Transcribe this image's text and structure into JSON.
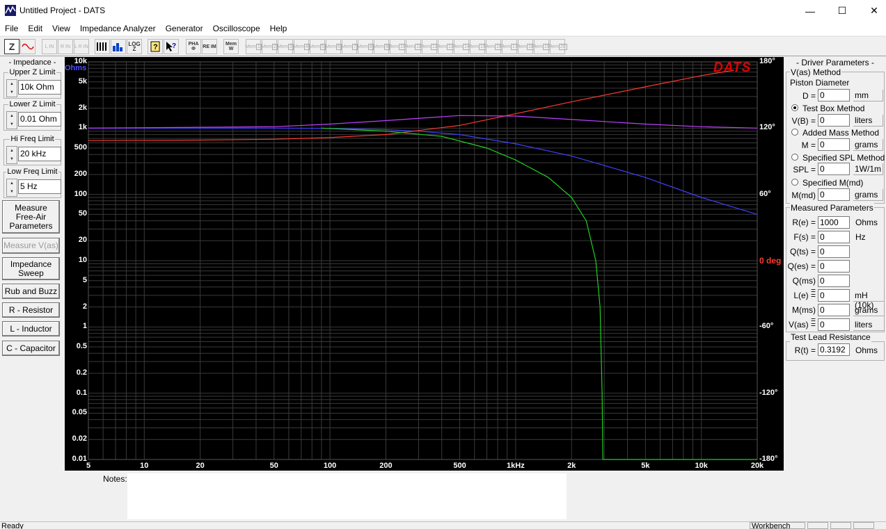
{
  "window": {
    "title": "Untitled Project - DATS"
  },
  "menu": [
    "File",
    "Edit",
    "View",
    "Impedance Analyzer",
    "Generator",
    "Oscilloscope",
    "Help"
  ],
  "toolbar": {
    "left_buttons": [
      "Z",
      "~"
    ],
    "lrl_buttons": [
      "L IN",
      "R IN",
      "L R IN"
    ],
    "view_buttons": [
      "bars",
      "blocks",
      "LOG Z",
      "?",
      "help-cursor",
      "PHA Φ",
      "RE IM",
      "Mem W"
    ],
    "mem_buttons": [
      "1",
      "2",
      "3",
      "4",
      "5",
      "6",
      "7",
      "8",
      "9",
      "10",
      "11",
      "12",
      "13",
      "14",
      "15",
      "16",
      "17",
      "18",
      "19",
      "20"
    ],
    "mem_prefix": "Mem"
  },
  "left": {
    "impedance_title": "- Impedance -",
    "upper_label": "Upper Z Limit",
    "upper_value": "10k Ohm",
    "lower_label": "Lower Z Limit",
    "lower_value": "0.01 Ohm",
    "hifreq_label": "Hi Freq Limit",
    "hifreq_value": "20 kHz",
    "lowfreq_label": "Low Freq Limit",
    "lowfreq_value": "5 Hz",
    "buttons": [
      "Measure Free-Air Parameters",
      "Measure V(as)",
      "Impedance Sweep",
      "Rub and Buzz",
      "R - Resistor",
      "L - Inductor",
      "C - Capacitor"
    ]
  },
  "right": {
    "driver_title": "- Driver Parameters -",
    "vas_method": "V(as) Method",
    "piston": "Piston Diameter",
    "d_label": "D =",
    "d_value": "0",
    "d_unit": "mm",
    "test_box": "Test Box Method",
    "vb_label": "V(B) =",
    "vb_value": "0",
    "vb_unit": "liters",
    "added_mass": "Added Mass Method",
    "m_label": "M =",
    "m_value": "0",
    "m_unit": "grams",
    "spl_method": "Specified SPL Method",
    "spl_label": "SPL =",
    "spl_value": "0",
    "spl_unit": "1W/1m",
    "spec_m": "Specified M(md)",
    "mmd_label": "M(md) =",
    "mmd_value": "0",
    "mmd_unit": "grams",
    "measured_title": "Measured Parameters",
    "params": [
      {
        "label": "R(e) =",
        "value": "1000",
        "unit": "Ohms"
      },
      {
        "label": "F(s) =",
        "value": "0",
        "unit": "Hz"
      },
      {
        "label": "Q(ts) =",
        "value": "0",
        "unit": ""
      },
      {
        "label": "Q(es) =",
        "value": "0",
        "unit": ""
      },
      {
        "label": "Q(ms) =",
        "value": "0",
        "unit": ""
      },
      {
        "label": "L(e) =",
        "value": "0",
        "unit": "mH (10k)"
      },
      {
        "label": "M(ms) =",
        "value": "0",
        "unit": "grams"
      },
      {
        "label": "V(as) =",
        "value": "0",
        "unit": "liters"
      }
    ],
    "lead_title": "Test Lead Resistance",
    "rt_label": "R(t) =",
    "rt_value": "0.3192",
    "rt_unit": "Ohms"
  },
  "notes_label": "Notes:",
  "status": {
    "left": "Ready",
    "right": "Workbench"
  },
  "colors": {
    "impedance": "#4040ff",
    "phase": "#ff3b2f",
    "magenta": "#c040ff",
    "green": "#20d020",
    "logo": "#e00000",
    "grid": "#3a3a3a"
  },
  "chart_data": {
    "type": "line",
    "logo": "DATS",
    "y_unit": "Ohms",
    "right_unit": "deg",
    "xlim": [
      5,
      20000
    ],
    "ylim": [
      0.01,
      10000
    ],
    "phase_lim": [
      -180,
      180
    ],
    "x_ticks": [
      {
        "v": 5,
        "l": "5"
      },
      {
        "v": 10,
        "l": "10"
      },
      {
        "v": 20,
        "l": "20"
      },
      {
        "v": 50,
        "l": "50"
      },
      {
        "v": 100,
        "l": "100"
      },
      {
        "v": 200,
        "l": "200"
      },
      {
        "v": 500,
        "l": "500"
      },
      {
        "v": 1000,
        "l": "1kHz"
      },
      {
        "v": 2000,
        "l": "2k"
      },
      {
        "v": 5000,
        "l": "5k"
      },
      {
        "v": 10000,
        "l": "10k"
      },
      {
        "v": 20000,
        "l": "20k"
      }
    ],
    "y_ticks": [
      {
        "v": 10000,
        "l": "10k"
      },
      {
        "v": 5000,
        "l": "5k"
      },
      {
        "v": 2000,
        "l": "2k"
      },
      {
        "v": 1000,
        "l": "1k"
      },
      {
        "v": 500,
        "l": "500"
      },
      {
        "v": 200,
        "l": "200"
      },
      {
        "v": 100,
        "l": "100"
      },
      {
        "v": 50,
        "l": "50"
      },
      {
        "v": 20,
        "l": "20"
      },
      {
        "v": 10,
        "l": "10"
      },
      {
        "v": 5,
        "l": "5"
      },
      {
        "v": 2,
        "l": "2"
      },
      {
        "v": 1,
        "l": "1"
      },
      {
        "v": 0.5,
        "l": "0.5"
      },
      {
        "v": 0.2,
        "l": "0.2"
      },
      {
        "v": 0.1,
        "l": "0.1"
      },
      {
        "v": 0.05,
        "l": "0.05"
      },
      {
        "v": 0.02,
        "l": "0.02"
      },
      {
        "v": 0.01,
        "l": "0.01"
      }
    ],
    "phase_ticks": [
      {
        "v": 180,
        "l": "180°"
      },
      {
        "v": 120,
        "l": "120°"
      },
      {
        "v": 60,
        "l": "60°"
      },
      {
        "v": 0,
        "l": "0 deg"
      },
      {
        "v": -60,
        "l": "-60°"
      },
      {
        "v": -120,
        "l": "-120°"
      },
      {
        "v": -180,
        "l": "-180°"
      }
    ],
    "series": [
      {
        "key": "blue",
        "axis": "z",
        "points": [
          [
            5,
            1000
          ],
          [
            50,
            1000
          ],
          [
            100,
            990
          ],
          [
            200,
            950
          ],
          [
            300,
            900
          ],
          [
            500,
            800
          ],
          [
            1000,
            580
          ],
          [
            2000,
            380
          ],
          [
            5000,
            180
          ],
          [
            10000,
            90
          ],
          [
            20000,
            50
          ]
        ]
      },
      {
        "key": "red",
        "axis": "z",
        "points": [
          [
            5,
            650
          ],
          [
            20,
            660
          ],
          [
            50,
            680
          ],
          [
            100,
            720
          ],
          [
            200,
            800
          ],
          [
            500,
            1100
          ],
          [
            1000,
            1650
          ],
          [
            2000,
            2500
          ],
          [
            5000,
            4200
          ],
          [
            10000,
            6200
          ],
          [
            15000,
            7500
          ]
        ]
      },
      {
        "key": "magenta",
        "axis": "z",
        "points": [
          [
            5,
            1000
          ],
          [
            50,
            1050
          ],
          [
            100,
            1150
          ],
          [
            200,
            1300
          ],
          [
            500,
            1550
          ],
          [
            1000,
            1520
          ],
          [
            2000,
            1350
          ],
          [
            5000,
            1150
          ],
          [
            10000,
            1050
          ],
          [
            20000,
            1000
          ]
        ]
      },
      {
        "key": "green",
        "axis": "z",
        "points": [
          [
            90,
            1000
          ],
          [
            200,
            900
          ],
          [
            400,
            750
          ],
          [
            700,
            500
          ],
          [
            1000,
            330
          ],
          [
            1500,
            180
          ],
          [
            2000,
            90
          ],
          [
            2400,
            40
          ],
          [
            2700,
            10
          ],
          [
            2850,
            2
          ],
          [
            2920,
            0.1
          ],
          [
            2950,
            0.01
          ],
          [
            20000,
            0.01
          ]
        ]
      }
    ]
  }
}
